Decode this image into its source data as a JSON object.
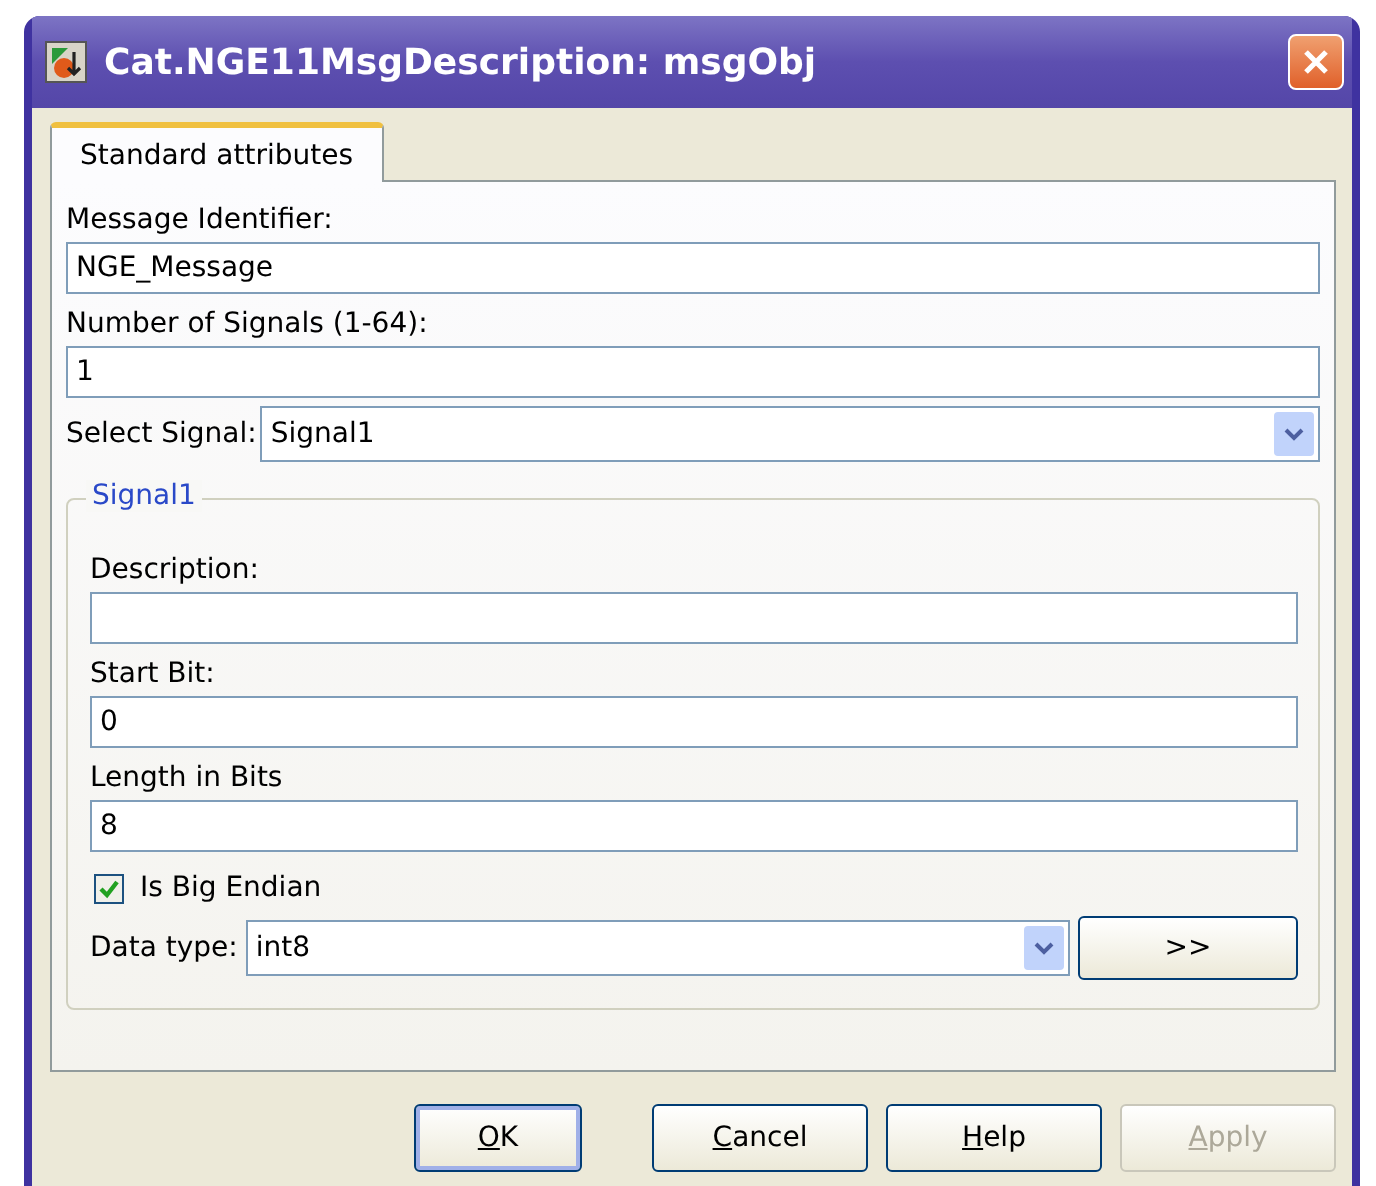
{
  "window": {
    "title": "Cat.NGE11MsgDescription: msgObj"
  },
  "tabs": [
    {
      "label": "Standard attributes",
      "selected": true
    }
  ],
  "fields": [
    {
      "label": "Message Identifier:",
      "value": "NGE_Message"
    },
    {
      "label": "Number of Signals (1-64):",
      "value": "1"
    }
  ],
  "select_signal": {
    "label": "Select Signal:",
    "value": "Signal1"
  },
  "group": {
    "title": "Signal1",
    "fields": [
      {
        "label": "Description:"
      },
      {
        "label": "Start Bit:",
        "value": "0"
      },
      {
        "label": "Length in Bits",
        "value": "8"
      }
    ],
    "big_endian": {
      "label": "Is Big Endian",
      "checked": true
    },
    "data_type": {
      "label": "Data type:",
      "value": "int8",
      "button": ">>"
    }
  },
  "buttons": [
    {
      "label": "OK",
      "mnemonic": true,
      "default": true,
      "disabled": false
    },
    {
      "label": "Cancel",
      "mnemonic": true,
      "default": false,
      "disabled": false
    },
    {
      "label": "Help",
      "mnemonic": true,
      "default": false,
      "disabled": false
    },
    {
      "label": "Apply",
      "mnemonic": true,
      "default": false,
      "disabled": true
    }
  ]
}
